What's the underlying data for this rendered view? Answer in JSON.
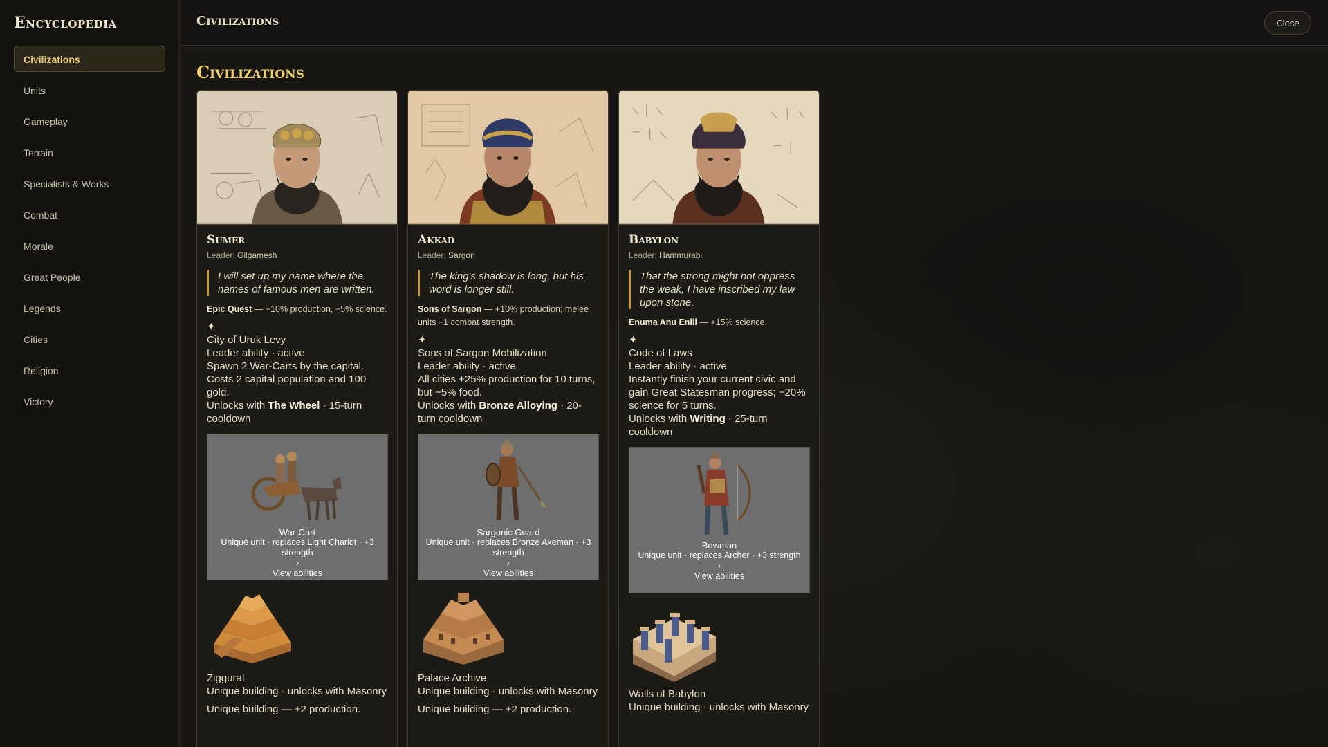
{
  "sidebar": {
    "title": "Encyclopedia",
    "items": [
      {
        "label": "Civilizations",
        "active": true
      },
      {
        "label": "Units"
      },
      {
        "label": "Gameplay"
      },
      {
        "label": "Terrain"
      },
      {
        "label": "Specialists & Works"
      },
      {
        "label": "Combat"
      },
      {
        "label": "Morale"
      },
      {
        "label": "Great People"
      },
      {
        "label": "Legends"
      },
      {
        "label": "Cities"
      },
      {
        "label": "Religion"
      },
      {
        "label": "Victory"
      }
    ]
  },
  "header": {
    "title": "Civilizations",
    "close_label": "Close"
  },
  "main": {
    "title": "Civilizations",
    "leader_prefix": "Leader:",
    "civs": [
      {
        "name": "Sumer",
        "leader": "Gilgamesh",
        "quote": "I will set up my name where the names of famous men are written.",
        "bonus_name": "Epic Quest",
        "bonus_text": " — +10% production, +5% science.",
        "ability_icon": "✦",
        "ability_name": "City of Uruk Levy",
        "ability_type": "Leader ability · active",
        "ability_desc": "Spawn 2 War-Carts by the capital. Costs 2 capital population and 100 gold.",
        "unlock_prefix": "Unlocks with ",
        "unlock_tech": "The Wheel",
        "unlock_suffix": " · 15-turn cooldown",
        "unit_name": "War-Cart",
        "unit_desc": "Unique unit · replaces Light Chariot · +3 strength",
        "unit_chevron": "›",
        "unit_link": "View abilities",
        "building_name": "Ziggurat",
        "building_type": "Unique building · unlocks with Masonry",
        "building_desc": "Unique building — +2 production."
      },
      {
        "name": "Akkad",
        "leader": "Sargon",
        "quote": "The king's shadow is long, but his word is longer still.",
        "bonus_name": "Sons of Sargon",
        "bonus_text": " — +10% production; melee units +1 combat strength.",
        "ability_icon": "✦",
        "ability_name": "Sons of Sargon Mobilization",
        "ability_type": "Leader ability · active",
        "ability_desc": "All cities +25% production for 10 turns, but −5% food.",
        "unlock_prefix": "Unlocks with ",
        "unlock_tech": "Bronze Alloying",
        "unlock_suffix": " · 20-turn cooldown",
        "unit_name": "Sargonic Guard",
        "unit_desc": "Unique unit · replaces Bronze Axeman · +3 strength",
        "unit_chevron": "›",
        "unit_link": "View abilities",
        "building_name": "Palace Archive",
        "building_type": "Unique building · unlocks with Masonry",
        "building_desc": "Unique building — +2 production."
      },
      {
        "name": "Babylon",
        "leader": "Hammurabi",
        "quote": "That the strong might not oppress the weak, I have inscribed my law upon stone.",
        "bonus_name": "Enuma Anu Enlil",
        "bonus_text": " — +15% science.",
        "ability_icon": "✦",
        "ability_name": "Code of Laws",
        "ability_type": "Leader ability · active",
        "ability_desc": "Instantly finish your current civic and gain Great Statesman progress; −20% science for 5 turns.",
        "unlock_prefix": "Unlocks with ",
        "unlock_tech": "Writing",
        "unlock_suffix": " · 25-turn cooldown",
        "unit_name": "Bowman",
        "unit_desc": "Unique unit · replaces Archer · +3 strength",
        "unit_chevron": "›",
        "unit_link": "View abilities",
        "building_name": "Walls of Babylon",
        "building_type": "Unique building · unlocks with Masonry",
        "building_desc": ""
      }
    ]
  }
}
